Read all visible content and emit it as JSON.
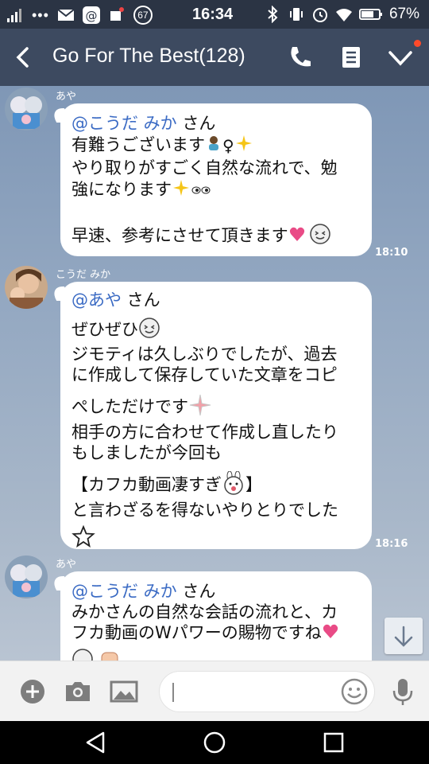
{
  "status_bar": {
    "time": "16:34",
    "battery": "67%",
    "notification_count": "67"
  },
  "header": {
    "title": "Go For The Best(128)"
  },
  "messages": [
    {
      "sender": "あや",
      "time": "18:10",
      "lines": {
        "l1_mention": "@こうだ みか",
        "l1_suffix": " さん",
        "l2": "有難うございます",
        "l3": "やり取りがすごく自然な流れで、勉",
        "l4": "強になります",
        "l5": "早速、参考にさせて頂きます"
      }
    },
    {
      "sender": "こうだ みか",
      "time": "18:16",
      "lines": {
        "l1_mention": "@あや",
        "l1_suffix": " さん",
        "l2": "ぜひぜひ",
        "l3": "ジモティは久しぶりでしたが、過去",
        "l4": "に作成して保存していた文章をコピ",
        "l5": "ぺしただけです",
        "l6": "相手の方に合わせて作成し直したり",
        "l7": "もしましたが今回も",
        "l8a": "【カフカ動画凄すぎ",
        "l8b": "】",
        "l9": "と言わざるを得ないやりとりでした"
      }
    },
    {
      "sender": "あや",
      "lines": {
        "l1_mention": "@こうだ みか",
        "l1_suffix": " さん",
        "l2": "みかさんの自然な会話の流れと、カ",
        "l3": "フカ動画のWパワーの賜物ですね"
      }
    }
  ],
  "icons": {
    "back": "back-arrow-icon",
    "phone": "phone-icon",
    "notes": "notes-icon",
    "collapse": "chevron-down-icon",
    "add": "add-icon",
    "camera": "camera-icon",
    "gallery": "image-icon",
    "sticker": "emoji-icon",
    "mic": "mic-icon"
  },
  "colors": {
    "header": "#3d4a60",
    "status_bar": "#2b3444",
    "mention": "#3b6bc4",
    "notification_dot": "#ff4a2a"
  }
}
